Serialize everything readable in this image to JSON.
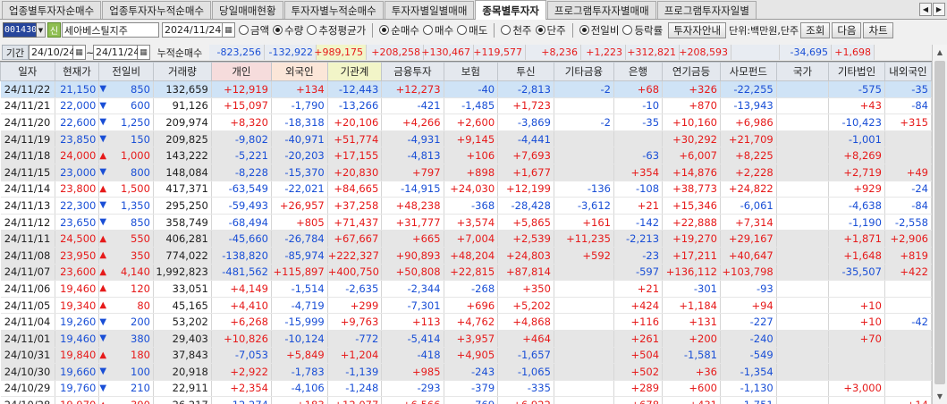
{
  "tabs": [
    {
      "label": "업종별투자자순매수",
      "active": false
    },
    {
      "label": "업종투자자누적순매수",
      "active": false
    },
    {
      "label": "당일매매현황",
      "active": false
    },
    {
      "label": "투자자별누적순매수",
      "active": false
    },
    {
      "label": "투자자별일별매매",
      "active": false
    },
    {
      "label": "종목별투자자",
      "active": true
    },
    {
      "label": "프로그램투자자별매매",
      "active": false
    },
    {
      "label": "프로그램투자자일별",
      "active": false
    }
  ],
  "tab_nav": {
    "prev": "◀",
    "next": "▶"
  },
  "options": {
    "code": "001430",
    "stock_name": "세아베스틸지주",
    "search_glyph": "신",
    "date": "2024/11/24",
    "value_type": [
      {
        "label": "금액",
        "on": false
      },
      {
        "label": "수량",
        "on": true
      },
      {
        "label": "추정평균가",
        "on": false
      }
    ],
    "trade_type": [
      {
        "label": "순매수",
        "on": true
      },
      {
        "label": "매수",
        "on": false
      },
      {
        "label": "매도",
        "on": false
      }
    ],
    "unit_type": [
      {
        "label": "천주",
        "on": false
      },
      {
        "label": "단주",
        "on": true
      }
    ],
    "compare_type": [
      {
        "label": "전일비",
        "on": true
      },
      {
        "label": "등락률",
        "on": false
      }
    ],
    "investor_btn": "투자자안내",
    "unit_text": "단위:백만원,단주",
    "search_btn": "조회",
    "next_btn": "다음",
    "chart_btn": "차트"
  },
  "period": {
    "label": "기간",
    "from": "24/10/24",
    "tilde": "~",
    "to": "24/11/24",
    "acc_label": "누적순매수"
  },
  "summary": [
    "-823,256",
    "-132,922",
    "+989,175",
    "+208,258",
    "+130,467",
    "+119,577",
    "+8,236",
    "+1,223",
    "+312,821",
    "+208,593",
    "",
    "-34,695",
    "+1,698"
  ],
  "summary_colors": [
    "b",
    "b",
    "r",
    "r",
    "r",
    "r",
    "r",
    "r",
    "r",
    "r",
    "k",
    "b",
    "r"
  ],
  "columns": [
    "일자",
    "현재가",
    "전일비",
    "거래량",
    "개인",
    "외국인",
    "기관계",
    "금융투자",
    "보험",
    "투신",
    "기타금융",
    "은행",
    "연기금등",
    "사모펀드",
    "국가",
    "기타법인",
    "내외국인"
  ],
  "rows": [
    {
      "date": "24/11/22",
      "price": "21,150",
      "dir": "down",
      "chg": "850",
      "vol": "132,659",
      "v": [
        "+12,919",
        "+134",
        "-12,443",
        "+12,273",
        "-40",
        "-2,813",
        "-2",
        "+68",
        "+326",
        "-22,255",
        "",
        "-575",
        "-35"
      ]
    },
    {
      "date": "24/11/21",
      "price": "22,000",
      "dir": "down",
      "chg": "600",
      "vol": "91,126",
      "v": [
        "+15,097",
        "-1,790",
        "-13,266",
        "-421",
        "-1,485",
        "+1,723",
        "",
        "-10",
        "+870",
        "-13,943",
        "",
        "+43",
        "-84"
      ]
    },
    {
      "date": "24/11/20",
      "price": "22,600",
      "dir": "down",
      "chg": "1,250",
      "vol": "209,974",
      "v": [
        "+8,320",
        "-18,318",
        "+20,106",
        "+4,266",
        "+2,600",
        "-3,869",
        "-2",
        "-35",
        "+10,160",
        "+6,986",
        "",
        "-10,423",
        "+315"
      ]
    },
    {
      "date": "24/11/19",
      "price": "23,850",
      "dir": "down",
      "chg": "150",
      "vol": "209,825",
      "v": [
        "-9,802",
        "-40,971",
        "+51,774",
        "-4,931",
        "+9,145",
        "-4,441",
        "",
        "",
        "+30,292",
        "+21,709",
        "",
        "-1,001",
        ""
      ]
    },
    {
      "date": "24/11/18",
      "price": "24,000",
      "dir": "up",
      "chg": "1,000",
      "vol": "143,222",
      "v": [
        "-5,221",
        "-20,203",
        "+17,155",
        "-4,813",
        "+106",
        "+7,693",
        "",
        "-63",
        "+6,007",
        "+8,225",
        "",
        "+8,269",
        ""
      ]
    },
    {
      "date": "24/11/15",
      "price": "23,000",
      "dir": "down",
      "chg": "800",
      "vol": "148,084",
      "v": [
        "-8,228",
        "-15,370",
        "+20,830",
        "+797",
        "+898",
        "+1,677",
        "",
        "+354",
        "+14,876",
        "+2,228",
        "",
        "+2,719",
        "+49"
      ]
    },
    {
      "date": "24/11/14",
      "price": "23,800",
      "dir": "up",
      "chg": "1,500",
      "vol": "417,371",
      "v": [
        "-63,549",
        "-22,021",
        "+84,665",
        "-14,915",
        "+24,030",
        "+12,199",
        "-136",
        "-108",
        "+38,773",
        "+24,822",
        "",
        "+929",
        "-24"
      ]
    },
    {
      "date": "24/11/13",
      "price": "22,300",
      "dir": "down",
      "chg": "1,350",
      "vol": "295,250",
      "v": [
        "-59,493",
        "+26,957",
        "+37,258",
        "+48,238",
        "-368",
        "-28,428",
        "-3,612",
        "+21",
        "+15,346",
        "-6,061",
        "",
        "-4,638",
        "-84"
      ]
    },
    {
      "date": "24/11/12",
      "price": "23,650",
      "dir": "down",
      "chg": "850",
      "vol": "358,749",
      "v": [
        "-68,494",
        "+805",
        "+71,437",
        "+31,777",
        "+3,574",
        "+5,865",
        "+161",
        "-142",
        "+22,888",
        "+7,314",
        "",
        "-1,190",
        "-2,558"
      ]
    },
    {
      "date": "24/11/11",
      "price": "24,500",
      "dir": "up",
      "chg": "550",
      "vol": "406,281",
      "v": [
        "-45,660",
        "-26,784",
        "+67,667",
        "+665",
        "+7,004",
        "+2,539",
        "+11,235",
        "-2,213",
        "+19,270",
        "+29,167",
        "",
        "+1,871",
        "+2,906"
      ]
    },
    {
      "date": "24/11/08",
      "price": "23,950",
      "dir": "up",
      "chg": "350",
      "vol": "774,022",
      "v": [
        "-138,820",
        "-85,974",
        "+222,327",
        "+90,893",
        "+48,204",
        "+24,803",
        "+592",
        "-23",
        "+17,211",
        "+40,647",
        "",
        "+1,648",
        "+819"
      ]
    },
    {
      "date": "24/11/07",
      "price": "23,600",
      "dir": "up",
      "chg": "4,140",
      "vol": "1,992,823",
      "v": [
        "-481,562",
        "+115,897",
        "+400,750",
        "+50,808",
        "+22,815",
        "+87,814",
        "",
        "-597",
        "+136,112",
        "+103,798",
        "",
        "-35,507",
        "+422"
      ]
    },
    {
      "date": "24/11/06",
      "price": "19,460",
      "dir": "up",
      "chg": "120",
      "vol": "33,051",
      "v": [
        "+4,149",
        "-1,514",
        "-2,635",
        "-2,344",
        "-268",
        "+350",
        "",
        "+21",
        "-301",
        "-93",
        "",
        "",
        ""
      ]
    },
    {
      "date": "24/11/05",
      "price": "19,340",
      "dir": "up",
      "chg": "80",
      "vol": "45,165",
      "v": [
        "+4,410",
        "-4,719",
        "+299",
        "-7,301",
        "+696",
        "+5,202",
        "",
        "+424",
        "+1,184",
        "+94",
        "",
        "+10",
        ""
      ]
    },
    {
      "date": "24/11/04",
      "price": "19,260",
      "dir": "down",
      "chg": "200",
      "vol": "53,202",
      "v": [
        "+6,268",
        "-15,999",
        "+9,763",
        "+113",
        "+4,762",
        "+4,868",
        "",
        "+116",
        "+131",
        "-227",
        "",
        "+10",
        "-42"
      ]
    },
    {
      "date": "24/11/01",
      "price": "19,460",
      "dir": "down",
      "chg": "380",
      "vol": "29,403",
      "v": [
        "+10,826",
        "-10,124",
        "-772",
        "-5,414",
        "+3,957",
        "+464",
        "",
        "+261",
        "+200",
        "-240",
        "",
        "+70",
        ""
      ]
    },
    {
      "date": "24/10/31",
      "price": "19,840",
      "dir": "up",
      "chg": "180",
      "vol": "37,843",
      "v": [
        "-7,053",
        "+5,849",
        "+1,204",
        "-418",
        "+4,905",
        "-1,657",
        "",
        "+504",
        "-1,581",
        "-549",
        "",
        "",
        ""
      ]
    },
    {
      "date": "24/10/30",
      "price": "19,660",
      "dir": "down",
      "chg": "100",
      "vol": "20,918",
      "v": [
        "+2,922",
        "-1,783",
        "-1,139",
        "+985",
        "-243",
        "-1,065",
        "",
        "+502",
        "+36",
        "-1,354",
        "",
        "",
        ""
      ]
    },
    {
      "date": "24/10/29",
      "price": "19,760",
      "dir": "down",
      "chg": "210",
      "vol": "22,911",
      "v": [
        "+2,354",
        "-4,106",
        "-1,248",
        "-293",
        "-379",
        "-335",
        "",
        "+289",
        "+600",
        "-1,130",
        "",
        "+3,000",
        ""
      ]
    },
    {
      "date": "24/10/28",
      "price": "19,970",
      "dir": "up",
      "chg": "390",
      "vol": "26,217",
      "v": [
        "-12,274",
        "+183",
        "+12,077",
        "+6,566",
        "-769",
        "+6,922",
        "",
        "+678",
        "+431",
        "-1,751",
        "",
        "",
        "+14"
      ]
    }
  ],
  "colors": {
    "up": "#e61a1a",
    "down": "#1a4fd6",
    "selected_row": "#cfe3f6",
    "grey_row": "#e6e6e6"
  },
  "icons": {
    "calendar": "calendar-icon",
    "dropdown": "chevron-down-icon",
    "search": "search-icon"
  }
}
